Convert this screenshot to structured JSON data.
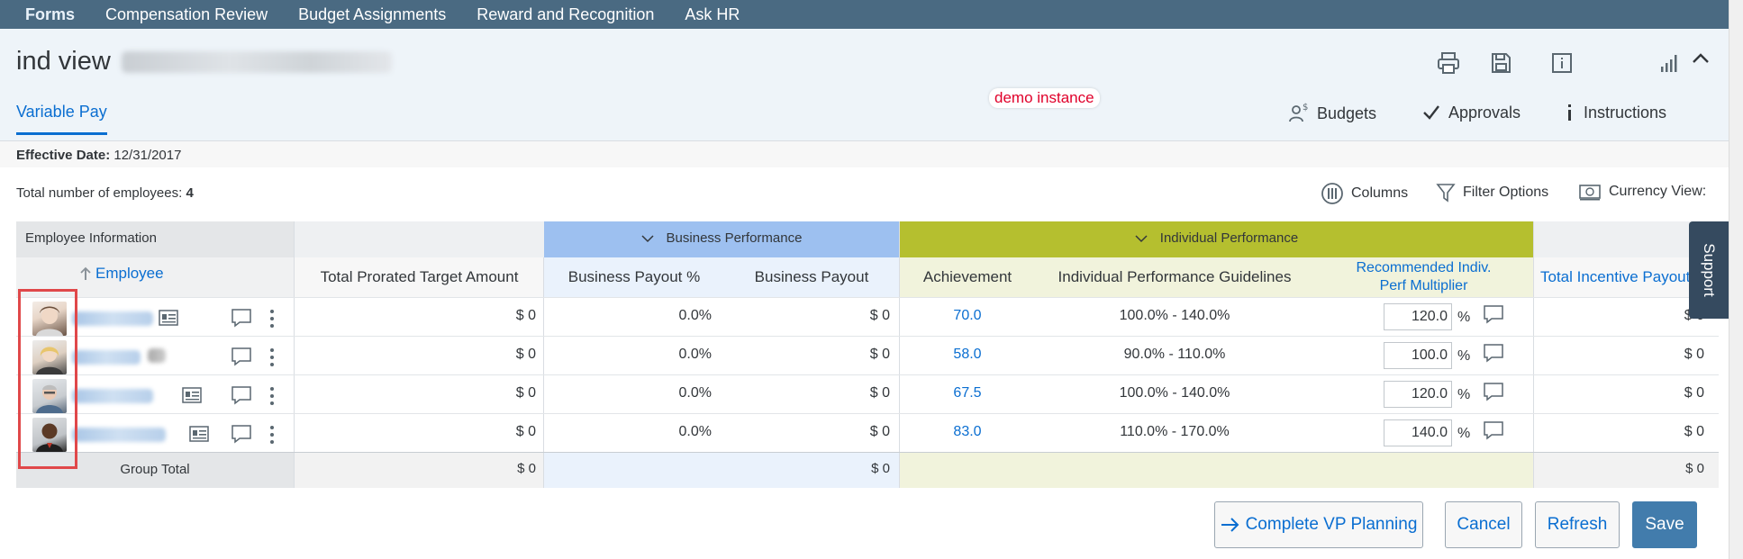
{
  "nav": {
    "items": [
      {
        "label": "Forms",
        "active": true
      },
      {
        "label": "Compensation Review",
        "active": false
      },
      {
        "label": "Budget Assignments",
        "active": false
      },
      {
        "label": "Reward and Recognition",
        "active": false
      },
      {
        "label": "Ask HR",
        "active": false
      }
    ]
  },
  "header": {
    "title": "ind view",
    "tab": "Variable Pay",
    "demo_badge": "demo instance",
    "actions": {
      "budgets": "Budgets",
      "approvals": "Approvals",
      "instructions": "Instructions"
    }
  },
  "effective": {
    "label": "Effective Date:",
    "value": "12/31/2017"
  },
  "summary": {
    "label": "Total number of employees:",
    "count": "4"
  },
  "toolbar": {
    "columns": "Columns",
    "filter": "Filter Options",
    "currency": "Currency View:"
  },
  "table": {
    "groups": {
      "employee_info": "Employee Information",
      "business": "Business Performance",
      "individual": "Individual Performance"
    },
    "headers": {
      "employee": "Employee",
      "target": "Total Prorated Target Amount",
      "bp_pct": "Business Payout %",
      "bp": "Business Payout",
      "achievement": "Achievement",
      "guidelines": "Individual Performance Guidelines",
      "multiplier_1": "Recommended Indiv.",
      "multiplier_2": "Perf Multiplier",
      "total_payout": "Total Incentive Payout"
    },
    "rows": [
      {
        "target": "$ 0",
        "bp_pct": "0.0%",
        "bp": "$ 0",
        "achievement": "70.0",
        "guidelines": "100.0% - 140.0%",
        "multiplier": "120.0",
        "unit": "%",
        "total": "$ 0"
      },
      {
        "target": "$ 0",
        "bp_pct": "0.0%",
        "bp": "$ 0",
        "achievement": "58.0",
        "guidelines": "90.0% - 110.0%",
        "multiplier": "100.0",
        "unit": "%",
        "total": "$ 0"
      },
      {
        "target": "$ 0",
        "bp_pct": "0.0%",
        "bp": "$ 0",
        "achievement": "67.5",
        "guidelines": "100.0% - 140.0%",
        "multiplier": "120.0",
        "unit": "%",
        "total": "$ 0"
      },
      {
        "target": "$ 0",
        "bp_pct": "0.0%",
        "bp": "$ 0",
        "achievement": "83.0",
        "guidelines": "110.0% - 170.0%",
        "multiplier": "140.0",
        "unit": "%",
        "total": "$ 0"
      }
    ],
    "group_total": {
      "label": "Group Total",
      "target": "$ 0",
      "bp": "$ 0",
      "total": "$ 0"
    }
  },
  "buttons": {
    "complete": "Complete VP Planning",
    "cancel": "Cancel",
    "refresh": "Refresh",
    "save": "Save"
  },
  "support": "Support",
  "colors": {
    "nav_bg": "#4a6a82",
    "accent": "#0a6ed1",
    "business_header": "#9dc0f0",
    "business_cell": "#eaf2fc",
    "individual_header": "#b5bf2f",
    "individual_cell": "#f1f3dc",
    "save_button": "#427cac",
    "demo_text": "#e0002a"
  }
}
